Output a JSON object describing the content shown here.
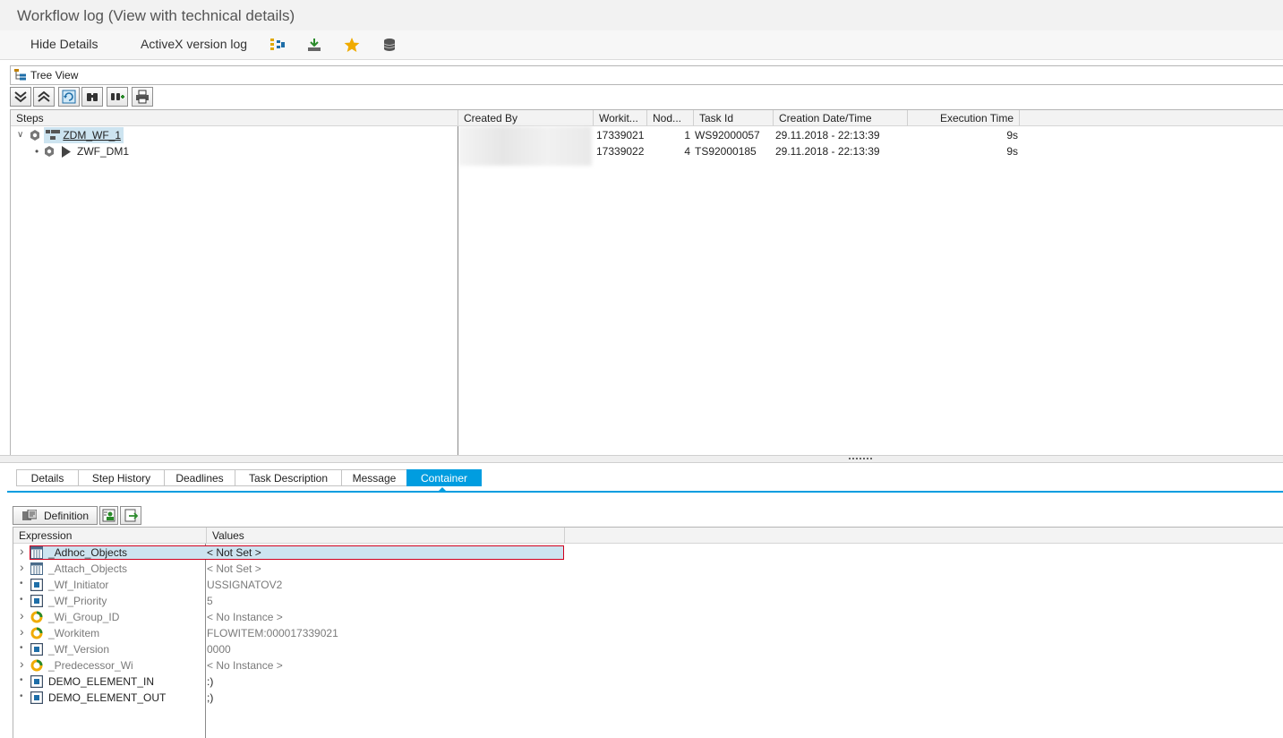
{
  "window": {
    "title": "Workflow log (View with technical details)"
  },
  "toolbar": {
    "hide_details": "Hide Details",
    "activex_log": "ActiveX version log",
    "icons": [
      "structure-icon",
      "export-icon",
      "favorite-star-icon",
      "database-icon"
    ]
  },
  "treeview": {
    "label": "Tree View"
  },
  "tree_toolbar": {
    "buttons": [
      "expand-all-icon",
      "collapse-all-icon",
      "refresh-icon",
      "find-icon",
      "find-next-icon",
      "print-icon"
    ]
  },
  "tree": {
    "columns": {
      "steps": "Steps",
      "created_by": "Created By",
      "workitem": "Workit...",
      "node": "Nod...",
      "task_id": "Task Id",
      "creation": "Creation Date/Time",
      "exec_time": "Execution Time"
    },
    "rows": [
      {
        "name": "ZDM_WF_1",
        "workitem": "17339021",
        "node": "1",
        "task_id": "WS92000057",
        "creation": "29.11.2018 - 22:13:39",
        "exec": "9s"
      },
      {
        "name": "ZWF_DM1",
        "workitem": "17339022",
        "node": "4",
        "task_id": "TS92000185",
        "creation": "29.11.2018 - 22:13:39",
        "exec": "9s"
      }
    ]
  },
  "tabs": [
    "Details",
    "Step History",
    "Deadlines",
    "Task Description",
    "Message",
    "Container"
  ],
  "active_tab": "Container",
  "container": {
    "definition_label": "Definition",
    "columns": {
      "expression": "Expression",
      "values": "Values"
    },
    "rows": [
      {
        "name": "_Adhoc_Objects",
        "value": "< Not Set >",
        "icon": "table-icon",
        "expandable": true,
        "system": false,
        "selected": true
      },
      {
        "name": "_Attach_Objects",
        "value": "< Not Set >",
        "icon": "table-icon",
        "expandable": true,
        "system": true
      },
      {
        "name": "_Wf_Initiator",
        "value": "USSIGNATOV2",
        "icon": "element-icon",
        "expandable": false,
        "system": true
      },
      {
        "name": "_Wf_Priority",
        "value": "5",
        "icon": "element-icon",
        "expandable": false,
        "system": true
      },
      {
        "name": "_Wi_Group_ID",
        "value": "< No Instance >",
        "icon": "object-icon",
        "expandable": true,
        "system": true
      },
      {
        "name": "_Workitem",
        "value": "FLOWITEM:000017339021",
        "icon": "object-icon",
        "expandable": true,
        "system": true
      },
      {
        "name": "_Wf_Version",
        "value": "0000",
        "icon": "element-icon",
        "expandable": false,
        "system": true
      },
      {
        "name": "_Predecessor_Wi",
        "value": "< No Instance >",
        "icon": "object-icon",
        "expandable": true,
        "system": true
      },
      {
        "name": "DEMO_ELEMENT_IN",
        "value": ":)",
        "icon": "element-icon",
        "expandable": false,
        "system": false
      },
      {
        "name": "DEMO_ELEMENT_OUT",
        "value": ";)",
        "icon": "element-icon",
        "expandable": false,
        "system": false
      }
    ]
  },
  "colors": {
    "accent": "#009de0",
    "selection": "#cde4f0",
    "selection_border": "#d0001d"
  }
}
